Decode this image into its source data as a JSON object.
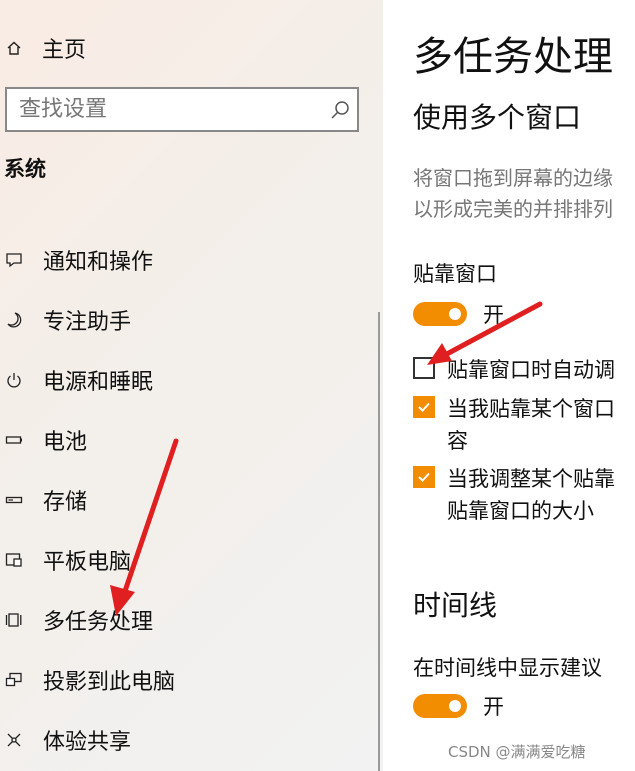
{
  "sidebar": {
    "home_label": "主页",
    "search_placeholder": "查找设置",
    "section_title": "系统",
    "items": [
      {
        "label": "通知和操作",
        "icon": "notification-icon"
      },
      {
        "label": "专注助手",
        "icon": "moon-icon"
      },
      {
        "label": "电源和睡眠",
        "icon": "power-icon"
      },
      {
        "label": "电池",
        "icon": "battery-icon"
      },
      {
        "label": "存储",
        "icon": "storage-icon"
      },
      {
        "label": "平板电脑",
        "icon": "tablet-icon"
      },
      {
        "label": "多任务处理",
        "icon": "multitasking-icon"
      },
      {
        "label": "投影到此电脑",
        "icon": "projector-icon"
      },
      {
        "label": "体验共享",
        "icon": "share-icon"
      }
    ]
  },
  "main": {
    "title": "多任务处理",
    "section1": {
      "heading": "使用多个窗口",
      "description_line1": "将窗口拖到屏幕的边缘",
      "description_line2": "以形成完美的并排排列",
      "snap_label": "贴靠窗口",
      "snap_toggle_state": "开",
      "checkboxes": [
        {
          "label_line1": "贴靠窗口时自动调",
          "label_line2": "",
          "checked": false
        },
        {
          "label_line1": "当我贴靠某个窗口",
          "label_line2": "容",
          "checked": true
        },
        {
          "label_line1": "当我调整某个贴靠",
          "label_line2": "贴靠窗口的大小",
          "checked": true
        }
      ]
    },
    "section2": {
      "heading": "时间线",
      "suggestion_label": "在时间线中显示建议",
      "suggestion_toggle_state": "开"
    }
  },
  "watermark": "CSDN @满满爱吃糖",
  "colors": {
    "accent": "#f28c00",
    "arrow": "#e02020"
  }
}
